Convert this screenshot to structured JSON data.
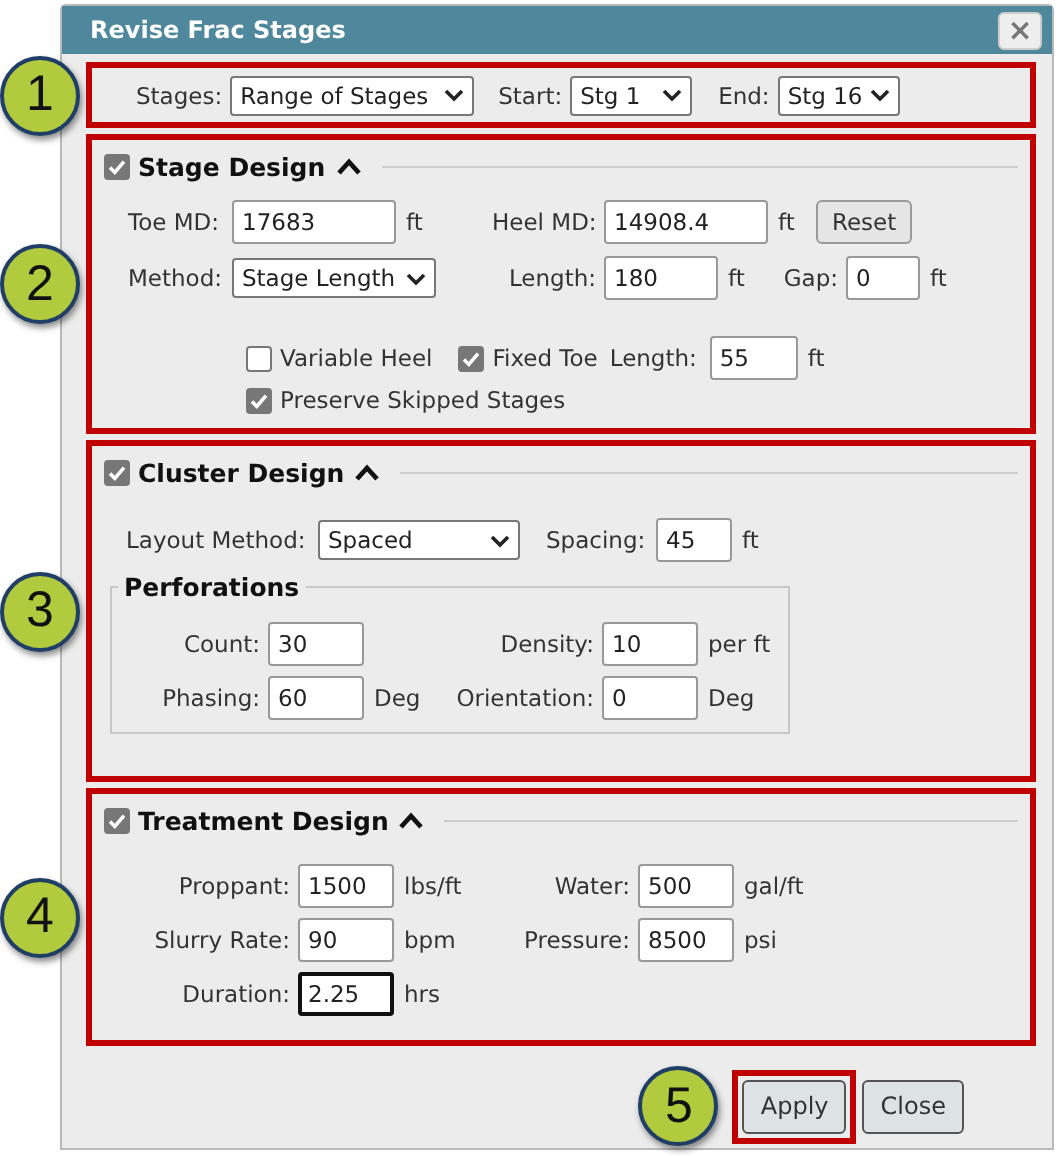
{
  "window": {
    "title": "Revise Frac Stages",
    "close": "×"
  },
  "stages_bar": {
    "callout": "1",
    "fields": [
      {
        "label": "Stages:",
        "value": "Range of Stages"
      },
      {
        "label": "Start:",
        "value": "Stg 1"
      },
      {
        "label": "End:",
        "value": "Stg 16"
      }
    ]
  },
  "stage_design": {
    "callout": "2",
    "title": "Stage Design",
    "checked": true,
    "expanded": true,
    "fields": [
      {
        "label": "Toe MD:",
        "value": "17683",
        "unit": "ft"
      },
      {
        "label": "Heel MD:",
        "value": "14908.4",
        "unit": "ft"
      },
      {
        "label": "Method:",
        "value": "Stage Length"
      },
      {
        "label": "Length:",
        "value": "180",
        "unit": "ft"
      },
      {
        "label": "Gap:",
        "value": "0",
        "unit": "ft"
      }
    ],
    "reset_button": "Reset",
    "options": [
      {
        "label": "Variable Heel",
        "checked": false
      },
      {
        "label": "Fixed Toe",
        "checked": true
      },
      {
        "label": "Preserve Skipped Stages",
        "checked": true
      }
    ],
    "fixed_toe_length": {
      "label": "Length:",
      "value": "55",
      "unit": "ft"
    }
  },
  "cluster_design": {
    "callout": "3",
    "title": "Cluster Design",
    "checked": true,
    "expanded": true,
    "layout_method": {
      "label": "Layout Method:",
      "value": "Spaced"
    },
    "spacing": {
      "label": "Spacing:",
      "value": "45",
      "unit": "ft"
    },
    "perforations": {
      "title": "Perforations",
      "fields": [
        {
          "label": "Count:",
          "value": "30"
        },
        {
          "label": "Density:",
          "value": "10",
          "unit": "per ft"
        },
        {
          "label": "Phasing:",
          "value": "60",
          "unit": "Deg"
        },
        {
          "label": "Orientation:",
          "value": "0",
          "unit": "Deg"
        }
      ]
    }
  },
  "treatment_design": {
    "callout": "4",
    "title": "Treatment Design",
    "checked": true,
    "expanded": true,
    "fields": [
      {
        "label": "Proppant:",
        "value": "1500",
        "unit": "lbs/ft",
        "focused": false
      },
      {
        "label": "Water:",
        "value": "500",
        "unit": "gal/ft",
        "focused": false
      },
      {
        "label": "Slurry Rate:",
        "value": "90",
        "unit": "bpm",
        "focused": false
      },
      {
        "label": "Pressure:",
        "value": "8500",
        "unit": "psi",
        "focused": false
      },
      {
        "label": "Duration:",
        "value": "2.25",
        "unit": "hrs",
        "focused": true
      }
    ]
  },
  "buttons": [
    {
      "label": "Apply",
      "highlighted": true,
      "callout": "5"
    },
    {
      "label": "Close",
      "highlighted": false
    }
  ]
}
